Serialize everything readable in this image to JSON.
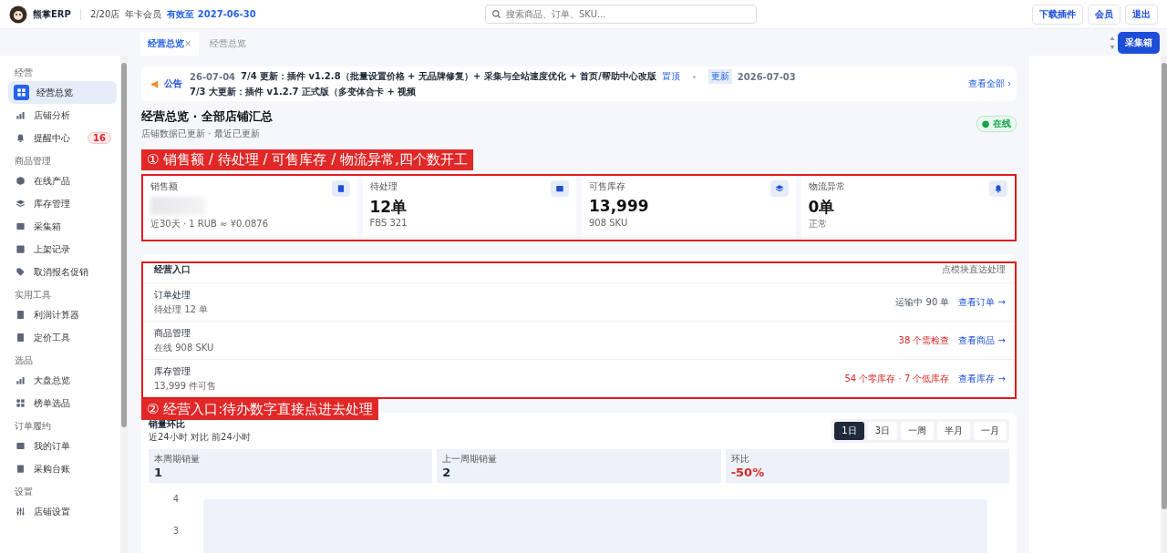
{
  "header": {
    "brand": "熊掌ERP",
    "stores": "2/20店",
    "plan": "年卡会员",
    "expiry": "有效至 2027-06-30",
    "search": {
      "placeholder": "搜索商品、订单、SKU..."
    },
    "buttons": [
      "下载插件",
      "会员",
      "退出"
    ]
  },
  "tabs": [
    {
      "label": "经营总览",
      "selected": true,
      "close": "×"
    },
    {
      "label": "经营总览",
      "selected": false
    }
  ],
  "collect_button": "采集箱",
  "sidebar": {
    "groups": [
      {
        "title": "经营",
        "items": [
          {
            "label": "经营总览",
            "selected": true
          },
          {
            "label": "店铺分析",
            "selected": false
          },
          {
            "label": "提醒中心",
            "selected": false,
            "badge": "16"
          }
        ]
      },
      {
        "title": "商品管理",
        "items": [
          {
            "label": "在线产品",
            "selected": false
          },
          {
            "label": "库存管理",
            "selected": false
          },
          {
            "label": "采集箱",
            "selected": false
          },
          {
            "label": "上架记录",
            "selected": false
          },
          {
            "label": "取消报名促销",
            "selected": false
          }
        ]
      },
      {
        "title": "实用工具",
        "items": [
          {
            "label": "利润计算器",
            "selected": false
          },
          {
            "label": "定价工具",
            "selected": false
          }
        ]
      },
      {
        "title": "选品",
        "items": [
          {
            "label": "大盘总览",
            "selected": false
          },
          {
            "label": "榜单选品",
            "selected": false
          }
        ]
      },
      {
        "title": "订单履约",
        "items": [
          {
            "label": "我的订单",
            "selected": false
          },
          {
            "label": "采购台账",
            "selected": false
          }
        ]
      },
      {
        "title": "设置",
        "items": [
          {
            "label": "店铺设置",
            "selected": false
          }
        ]
      }
    ]
  },
  "announcement": {
    "label": "公告",
    "items": [
      {
        "date": "26-07-04",
        "text": "7/4 更新：插件 v1.2.8（批量设置价格 + 无品牌修复）+ 采集与全站速度优化 + 首页/帮助中心改版",
        "tag": "置顶"
      },
      {
        "tag": "更新",
        "date": "2026-07-03",
        "text": "7/3 大更新：插件 v1.2.7 正式版（多变体合卡 + 视频"
      }
    ],
    "more": "查看全部 ›"
  },
  "page": {
    "title": "经营总览 · 全部店铺汇总",
    "subtitle": "店铺数据已更新 · 最近已更新",
    "status": "● 在线"
  },
  "annotations": [
    "① 销售额 / 待处理 / 可售库存 / 物流异常,四个数开工",
    "② 经营入口:待办数字直接点进去处理"
  ],
  "stats": [
    {
      "label": "销售额",
      "blurred": true,
      "note": "近30天 · 1 RUB ≈ ¥0.0876"
    },
    {
      "label": "待处理",
      "value": "12单",
      "note": "FBS 321"
    },
    {
      "label": "可售库存",
      "value": "13,999",
      "note": "908 SKU"
    },
    {
      "label": "物流异常",
      "value": "0单",
      "note": "正常"
    }
  ],
  "entries": {
    "title": "经营入口",
    "hint": "点模块直达处理",
    "rows": [
      {
        "name": "订单处理",
        "sub": "待处理 12 单",
        "info": "运输中 90 单",
        "alert": false,
        "link": "查看订单 →"
      },
      {
        "name": "商品管理",
        "sub": "在线 908 SKU",
        "info": "38 个需检查",
        "alert": true,
        "link": "查看商品 →"
      },
      {
        "name": "库存管理",
        "sub": "13,999 件可售",
        "info": "54 个零库存 · 7 个低库存",
        "alert": true,
        "link": "查看库存 →"
      }
    ]
  },
  "sales": {
    "title": "销量环比",
    "sub": "近24小时 对比 前24小时",
    "ranges": [
      {
        "label": "1日",
        "selected": true
      },
      {
        "label": "3日",
        "selected": false
      },
      {
        "label": "一周",
        "selected": false
      },
      {
        "label": "半月",
        "selected": false
      },
      {
        "label": "一月",
        "selected": false
      }
    ],
    "metrics": [
      {
        "label": "本周期销量",
        "value": "1",
        "negative": false
      },
      {
        "label": "上一周期销量",
        "value": "2",
        "negative": false
      },
      {
        "label": "环比",
        "value": "-50%",
        "negative": true
      }
    ],
    "y_ticks": [
      "4",
      "3"
    ]
  }
}
